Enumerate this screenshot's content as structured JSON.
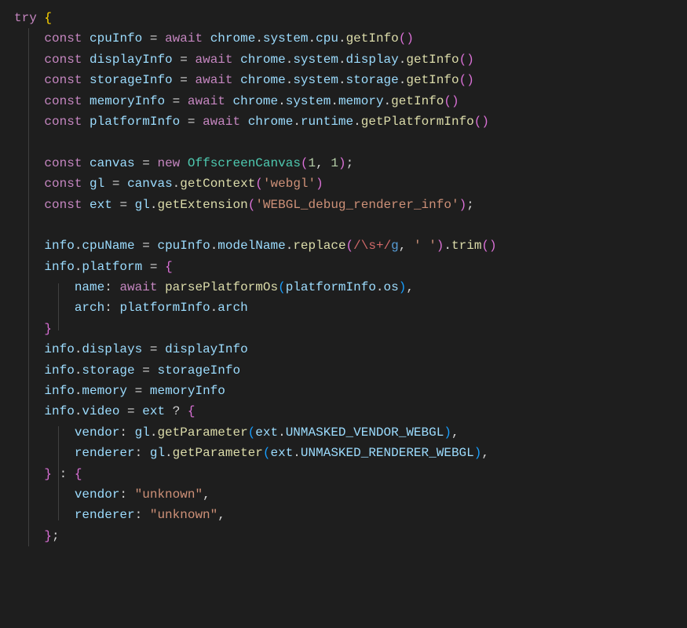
{
  "code": {
    "lines": [
      {
        "indent": 0,
        "tokens": [
          [
            "kw",
            "try"
          ],
          [
            "punct",
            " "
          ],
          [
            "brace",
            "{"
          ]
        ]
      },
      {
        "indent": 1,
        "tokens": [
          [
            "kw",
            "const"
          ],
          [
            "punct",
            " "
          ],
          [
            "var",
            "cpuInfo"
          ],
          [
            "punct",
            " "
          ],
          [
            "op",
            "="
          ],
          [
            "punct",
            " "
          ],
          [
            "kw",
            "await"
          ],
          [
            "punct",
            " "
          ],
          [
            "var",
            "chrome"
          ],
          [
            "punct",
            "."
          ],
          [
            "prop",
            "system"
          ],
          [
            "punct",
            "."
          ],
          [
            "prop",
            "cpu"
          ],
          [
            "punct",
            "."
          ],
          [
            "func",
            "getInfo"
          ],
          [
            "paren",
            "()"
          ]
        ]
      },
      {
        "indent": 1,
        "tokens": [
          [
            "kw",
            "const"
          ],
          [
            "punct",
            " "
          ],
          [
            "var",
            "displayInfo"
          ],
          [
            "punct",
            " "
          ],
          [
            "op",
            "="
          ],
          [
            "punct",
            " "
          ],
          [
            "kw",
            "await"
          ],
          [
            "punct",
            " "
          ],
          [
            "var",
            "chrome"
          ],
          [
            "punct",
            "."
          ],
          [
            "prop",
            "system"
          ],
          [
            "punct",
            "."
          ],
          [
            "prop",
            "display"
          ],
          [
            "punct",
            "."
          ],
          [
            "func",
            "getInfo"
          ],
          [
            "paren",
            "()"
          ]
        ]
      },
      {
        "indent": 1,
        "tokens": [
          [
            "kw",
            "const"
          ],
          [
            "punct",
            " "
          ],
          [
            "var",
            "storageInfo"
          ],
          [
            "punct",
            " "
          ],
          [
            "op",
            "="
          ],
          [
            "punct",
            " "
          ],
          [
            "kw",
            "await"
          ],
          [
            "punct",
            " "
          ],
          [
            "var",
            "chrome"
          ],
          [
            "punct",
            "."
          ],
          [
            "prop",
            "system"
          ],
          [
            "punct",
            "."
          ],
          [
            "prop",
            "storage"
          ],
          [
            "punct",
            "."
          ],
          [
            "func",
            "getInfo"
          ],
          [
            "paren",
            "()"
          ]
        ]
      },
      {
        "indent": 1,
        "tokens": [
          [
            "kw",
            "const"
          ],
          [
            "punct",
            " "
          ],
          [
            "var",
            "memoryInfo"
          ],
          [
            "punct",
            " "
          ],
          [
            "op",
            "="
          ],
          [
            "punct",
            " "
          ],
          [
            "kw",
            "await"
          ],
          [
            "punct",
            " "
          ],
          [
            "var",
            "chrome"
          ],
          [
            "punct",
            "."
          ],
          [
            "prop",
            "system"
          ],
          [
            "punct",
            "."
          ],
          [
            "prop",
            "memory"
          ],
          [
            "punct",
            "."
          ],
          [
            "func",
            "getInfo"
          ],
          [
            "paren",
            "()"
          ]
        ]
      },
      {
        "indent": 1,
        "tokens": [
          [
            "kw",
            "const"
          ],
          [
            "punct",
            " "
          ],
          [
            "var",
            "platformInfo"
          ],
          [
            "punct",
            " "
          ],
          [
            "op",
            "="
          ],
          [
            "punct",
            " "
          ],
          [
            "kw",
            "await"
          ],
          [
            "punct",
            " "
          ],
          [
            "var",
            "chrome"
          ],
          [
            "punct",
            "."
          ],
          [
            "prop",
            "runtime"
          ],
          [
            "punct",
            "."
          ],
          [
            "func",
            "getPlatformInfo"
          ],
          [
            "paren",
            "()"
          ]
        ]
      },
      {
        "indent": 1,
        "tokens": []
      },
      {
        "indent": 1,
        "tokens": [
          [
            "kw",
            "const"
          ],
          [
            "punct",
            " "
          ],
          [
            "var",
            "canvas"
          ],
          [
            "punct",
            " "
          ],
          [
            "op",
            "="
          ],
          [
            "punct",
            " "
          ],
          [
            "kw",
            "new"
          ],
          [
            "punct",
            " "
          ],
          [
            "class",
            "OffscreenCanvas"
          ],
          [
            "paren",
            "("
          ],
          [
            "num",
            "1"
          ],
          [
            "punct",
            ", "
          ],
          [
            "num",
            "1"
          ],
          [
            "paren",
            ")"
          ],
          [
            "punct",
            ";"
          ]
        ]
      },
      {
        "indent": 1,
        "tokens": [
          [
            "kw",
            "const"
          ],
          [
            "punct",
            " "
          ],
          [
            "var",
            "gl"
          ],
          [
            "punct",
            " "
          ],
          [
            "op",
            "="
          ],
          [
            "punct",
            " "
          ],
          [
            "var",
            "canvas"
          ],
          [
            "punct",
            "."
          ],
          [
            "func",
            "getContext"
          ],
          [
            "paren",
            "("
          ],
          [
            "str",
            "'webgl'"
          ],
          [
            "paren",
            ")"
          ]
        ]
      },
      {
        "indent": 1,
        "tokens": [
          [
            "kw",
            "const"
          ],
          [
            "punct",
            " "
          ],
          [
            "var",
            "ext"
          ],
          [
            "punct",
            " "
          ],
          [
            "op",
            "="
          ],
          [
            "punct",
            " "
          ],
          [
            "var",
            "gl"
          ],
          [
            "punct",
            "."
          ],
          [
            "func",
            "getExtension"
          ],
          [
            "paren",
            "("
          ],
          [
            "str",
            "'WEBGL_debug_renderer_info'"
          ],
          [
            "paren",
            ")"
          ],
          [
            "punct",
            ";"
          ]
        ]
      },
      {
        "indent": 1,
        "tokens": []
      },
      {
        "indent": 1,
        "tokens": [
          [
            "var",
            "info"
          ],
          [
            "punct",
            "."
          ],
          [
            "prop",
            "cpuName"
          ],
          [
            "punct",
            " "
          ],
          [
            "op",
            "="
          ],
          [
            "punct",
            " "
          ],
          [
            "var",
            "cpuInfo"
          ],
          [
            "punct",
            "."
          ],
          [
            "prop",
            "modelName"
          ],
          [
            "punct",
            "."
          ],
          [
            "func",
            "replace"
          ],
          [
            "paren",
            "("
          ],
          [
            "regex",
            "/\\s+/"
          ],
          [
            "regexflag",
            "g"
          ],
          [
            "punct",
            ", "
          ],
          [
            "str",
            "' '"
          ],
          [
            "paren",
            ")"
          ],
          [
            "punct",
            "."
          ],
          [
            "func",
            "trim"
          ],
          [
            "paren",
            "()"
          ]
        ]
      },
      {
        "indent": 1,
        "tokens": [
          [
            "var",
            "info"
          ],
          [
            "punct",
            "."
          ],
          [
            "prop",
            "platform"
          ],
          [
            "punct",
            " "
          ],
          [
            "op",
            "="
          ],
          [
            "punct",
            " "
          ],
          [
            "brace2",
            "{"
          ]
        ]
      },
      {
        "indent": 2,
        "tokens": [
          [
            "prop",
            "name"
          ],
          [
            "punct",
            ":"
          ],
          [
            "punct",
            " "
          ],
          [
            "kw",
            "await"
          ],
          [
            "punct",
            " "
          ],
          [
            "func",
            "parsePlatformOs"
          ],
          [
            "paren2",
            "("
          ],
          [
            "var",
            "platformInfo"
          ],
          [
            "punct",
            "."
          ],
          [
            "prop",
            "os"
          ],
          [
            "paren2",
            ")"
          ],
          [
            "punct",
            ","
          ]
        ]
      },
      {
        "indent": 2,
        "tokens": [
          [
            "prop",
            "arch"
          ],
          [
            "punct",
            ":"
          ],
          [
            "punct",
            " "
          ],
          [
            "var",
            "platformInfo"
          ],
          [
            "punct",
            "."
          ],
          [
            "prop",
            "arch"
          ]
        ]
      },
      {
        "indent": 1,
        "tokens": [
          [
            "brace2",
            "}"
          ]
        ]
      },
      {
        "indent": 1,
        "tokens": [
          [
            "var",
            "info"
          ],
          [
            "punct",
            "."
          ],
          [
            "prop",
            "displays"
          ],
          [
            "punct",
            " "
          ],
          [
            "op",
            "="
          ],
          [
            "punct",
            " "
          ],
          [
            "var",
            "displayInfo"
          ]
        ]
      },
      {
        "indent": 1,
        "tokens": [
          [
            "var",
            "info"
          ],
          [
            "punct",
            "."
          ],
          [
            "prop",
            "storage"
          ],
          [
            "punct",
            " "
          ],
          [
            "op",
            "="
          ],
          [
            "punct",
            " "
          ],
          [
            "var",
            "storageInfo"
          ]
        ]
      },
      {
        "indent": 1,
        "tokens": [
          [
            "var",
            "info"
          ],
          [
            "punct",
            "."
          ],
          [
            "prop",
            "memory"
          ],
          [
            "punct",
            " "
          ],
          [
            "op",
            "="
          ],
          [
            "punct",
            " "
          ],
          [
            "var",
            "memoryInfo"
          ]
        ]
      },
      {
        "indent": 1,
        "tokens": [
          [
            "var",
            "info"
          ],
          [
            "punct",
            "."
          ],
          [
            "prop",
            "video"
          ],
          [
            "punct",
            " "
          ],
          [
            "op",
            "="
          ],
          [
            "punct",
            " "
          ],
          [
            "var",
            "ext"
          ],
          [
            "punct",
            " "
          ],
          [
            "op",
            "?"
          ],
          [
            "punct",
            " "
          ],
          [
            "brace2",
            "{"
          ]
        ]
      },
      {
        "indent": 2,
        "tokens": [
          [
            "prop",
            "vendor"
          ],
          [
            "punct",
            ":"
          ],
          [
            "punct",
            " "
          ],
          [
            "var",
            "gl"
          ],
          [
            "punct",
            "."
          ],
          [
            "func",
            "getParameter"
          ],
          [
            "paren2",
            "("
          ],
          [
            "var",
            "ext"
          ],
          [
            "punct",
            "."
          ],
          [
            "prop",
            "UNMASKED_VENDOR_WEBGL"
          ],
          [
            "paren2",
            ")"
          ],
          [
            "punct",
            ","
          ]
        ]
      },
      {
        "indent": 2,
        "tokens": [
          [
            "prop",
            "renderer"
          ],
          [
            "punct",
            ":"
          ],
          [
            "punct",
            " "
          ],
          [
            "var",
            "gl"
          ],
          [
            "punct",
            "."
          ],
          [
            "func",
            "getParameter"
          ],
          [
            "paren2",
            "("
          ],
          [
            "var",
            "ext"
          ],
          [
            "punct",
            "."
          ],
          [
            "prop",
            "UNMASKED_RENDERER_WEBGL"
          ],
          [
            "paren2",
            ")"
          ],
          [
            "punct",
            ","
          ]
        ]
      },
      {
        "indent": 1,
        "tokens": [
          [
            "brace2",
            "}"
          ],
          [
            "punct",
            " "
          ],
          [
            "op",
            ":"
          ],
          [
            "punct",
            " "
          ],
          [
            "brace2",
            "{"
          ]
        ]
      },
      {
        "indent": 2,
        "tokens": [
          [
            "prop",
            "vendor"
          ],
          [
            "punct",
            ":"
          ],
          [
            "punct",
            " "
          ],
          [
            "str",
            "\"unknown\""
          ],
          [
            "punct",
            ","
          ]
        ]
      },
      {
        "indent": 2,
        "tokens": [
          [
            "prop",
            "renderer"
          ],
          [
            "punct",
            ":"
          ],
          [
            "punct",
            " "
          ],
          [
            "str",
            "\"unknown\""
          ],
          [
            "punct",
            ","
          ]
        ]
      },
      {
        "indent": 1,
        "tokens": [
          [
            "brace2",
            "}"
          ],
          [
            "punct",
            ";"
          ]
        ]
      }
    ],
    "indentUnit": "    "
  }
}
